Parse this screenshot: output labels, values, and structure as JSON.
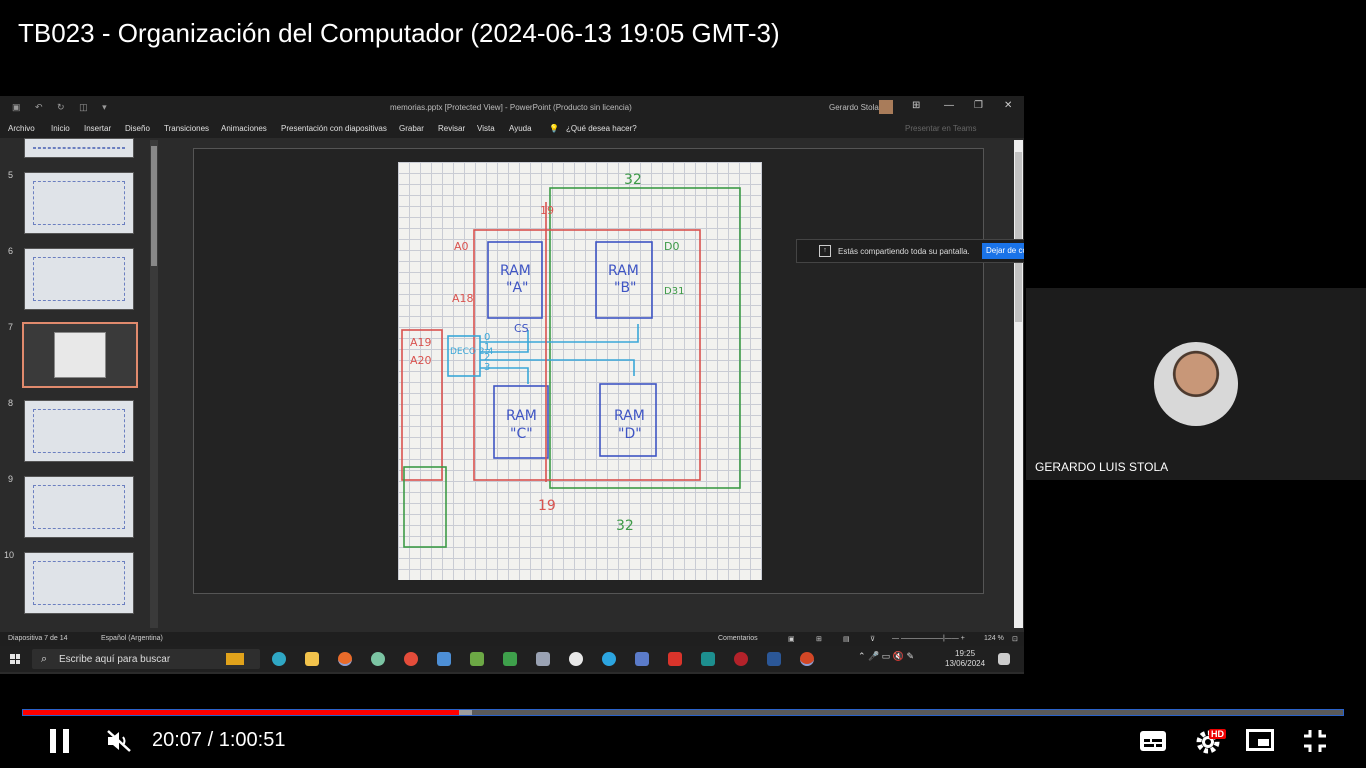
{
  "video": {
    "title": "TB023 - Organización del Computador (2024-06-13 19:05 GMT-3)",
    "current_time": "20:07",
    "duration": "1:00:51",
    "time_display": "20:07 / 1:00:51",
    "played_fraction": 0.33,
    "buffered_fraction": 0.34,
    "quality_badge": "HD",
    "muted": true,
    "icons": [
      "pause-icon",
      "muted-volume-icon",
      "subtitles-icon",
      "settings-icon",
      "miniplayer-icon",
      "exit-fullscreen-icon"
    ]
  },
  "powerpoint": {
    "doc_title": "memorias.pptx [Protected View]  -  PowerPoint (Producto sin licencia)",
    "user": "Gerardo Stola",
    "ribbon": [
      "Archivo",
      "Inicio",
      "Insertar",
      "Diseño",
      "Transiciones",
      "Animaciones",
      "Presentación con diapositivas",
      "Grabar",
      "Revisar",
      "Vista",
      "Ayuda",
      "¿Qué desea hacer?",
      "Presentar en Teams"
    ],
    "thumbnails": [
      {
        "num": "5"
      },
      {
        "num": "6"
      },
      {
        "num": "7",
        "active": true
      },
      {
        "num": "8"
      },
      {
        "num": "9"
      },
      {
        "num": "10"
      }
    ],
    "status": {
      "slide_counter": "Diapositiva 7 de 14",
      "language": "Español (Argentina)",
      "comments": "Comentarios",
      "zoom": "124 %"
    }
  },
  "diagram": {
    "labels": [
      "32",
      "19",
      "RAM",
      "\"A\"",
      "RAM",
      "\"B\"",
      "RAM",
      "\"C\"",
      "RAM",
      "\"D\"",
      "A0",
      "A18",
      "A19",
      "A20",
      "D0",
      "D31",
      "CS",
      "DECO 2:4",
      "0",
      "1",
      "2",
      "3",
      "19",
      "32"
    ]
  },
  "share_notice": {
    "text": "Estás compartiendo toda su pantalla.",
    "button": "Dejar de co"
  },
  "taskbar": {
    "search_placeholder": "Escribe aquí para buscar",
    "time": "19:25",
    "date": "13/06/2024"
  },
  "participant": {
    "name": "GERARDO LUIS STOLA"
  },
  "colors": {
    "progress_played": "#ff0000",
    "progress_border": "#2a62c9",
    "share_button": "#1a73e8",
    "active_thumb_border": "#e08a6d",
    "ink_blue": "#3f55c4",
    "ink_red": "#d9534f",
    "ink_green": "#3d9a47",
    "ink_cyan": "#3aa7d8"
  }
}
